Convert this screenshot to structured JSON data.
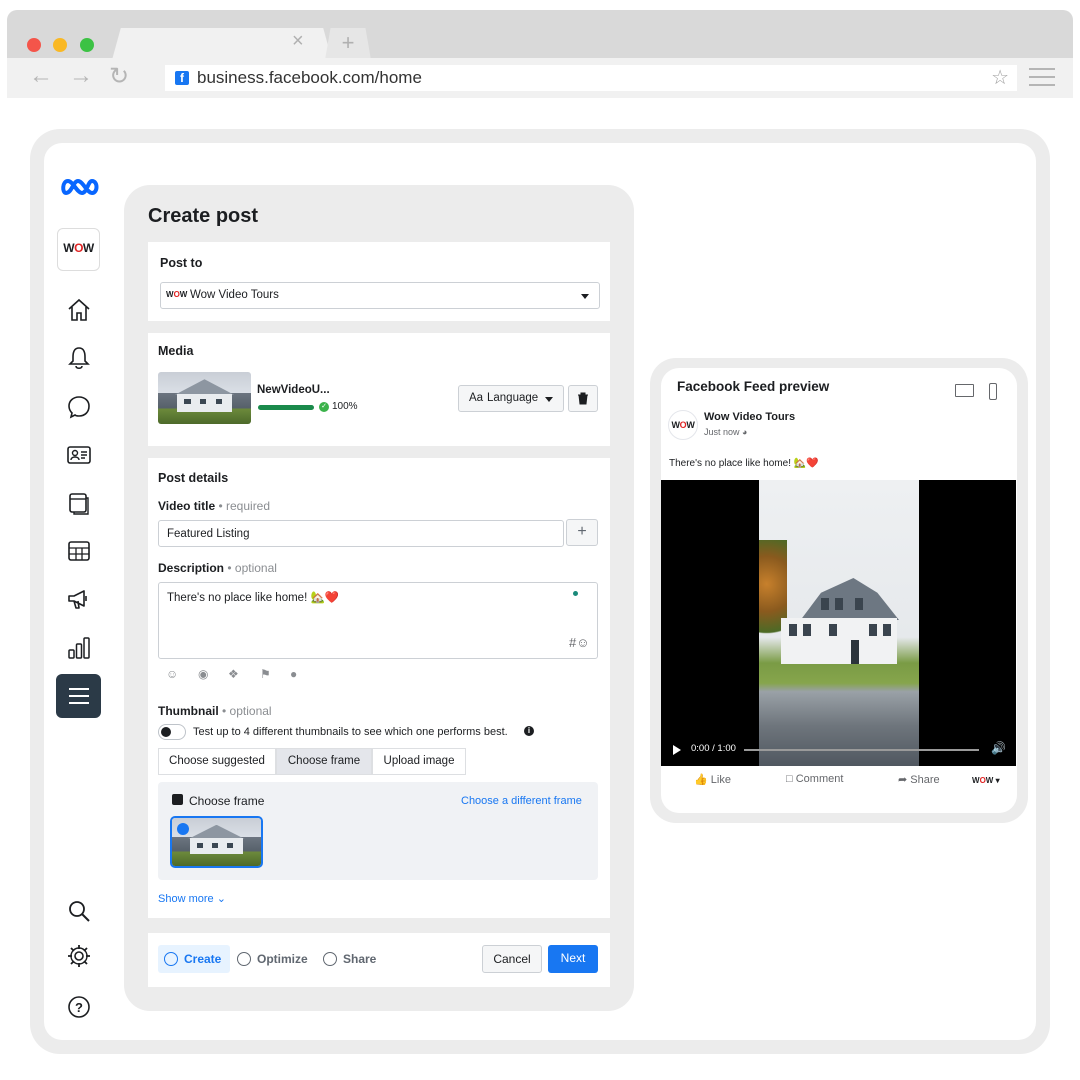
{
  "browser": {
    "url": "business.facebook.com/home",
    "favicon_letter": "f",
    "tab_close_glyph": "×",
    "tab_new_glyph": "+"
  },
  "rail": {
    "logo": "meta-logo",
    "page_avatar_text": "WOW",
    "items": [
      "home-icon",
      "notifications-icon",
      "messages-icon",
      "contacts-icon",
      "content-icon",
      "planner-icon",
      "ads-icon",
      "insights-icon",
      "all-tools-icon"
    ],
    "bottom": [
      "search-icon",
      "settings-icon",
      "help-icon"
    ]
  },
  "create_post": {
    "title": "Create post",
    "post_to": {
      "label": "Post to",
      "value": "Wow Video Tours"
    },
    "media": {
      "label": "Media",
      "file_name": "NewVideoU...",
      "progress_value": 1.0,
      "progress_text": "100%",
      "language_prefix": "Aa",
      "language_label": "Language"
    },
    "post_details": {
      "label": "Post details",
      "video_title_label": "Video title",
      "video_title_hint": "• required",
      "video_title_value": "Featured Listing",
      "description_label": "Description",
      "description_hint": "• optional",
      "description_value": "There's no place like home! 🏡❤️",
      "description_tools": "#☺",
      "thumbnail_label": "Thumbnail",
      "thumbnail_hint": "• optional",
      "thumbnail_test_text": "Test up to 4 different thumbnails to see which one performs best.",
      "thumbnail_tabs": [
        "Choose suggested",
        "Choose frame",
        "Upload image"
      ],
      "active_tab": "Choose frame",
      "choose_frame_title": "Choose frame",
      "choose_frame_link": "Choose a different frame",
      "show_more": "Show more"
    },
    "footer": {
      "steps": [
        "Create",
        "Optimize",
        "Share"
      ],
      "active_step": "Create",
      "cancel_label": "Cancel",
      "next_label": "Next"
    }
  },
  "preview": {
    "title": "Facebook Feed preview",
    "page_name": "Wow Video Tours",
    "timestamp": "Just now",
    "caption": "There's no place like home! 🏡❤️",
    "video_time": "0:00 / 1:00",
    "actions": [
      "Like",
      "Comment",
      "Share"
    ]
  },
  "colors": {
    "accent": "#1877f2",
    "progress": "#1a8a4b",
    "rail_active": "#2b3a47",
    "brand_red": "#e02424"
  }
}
